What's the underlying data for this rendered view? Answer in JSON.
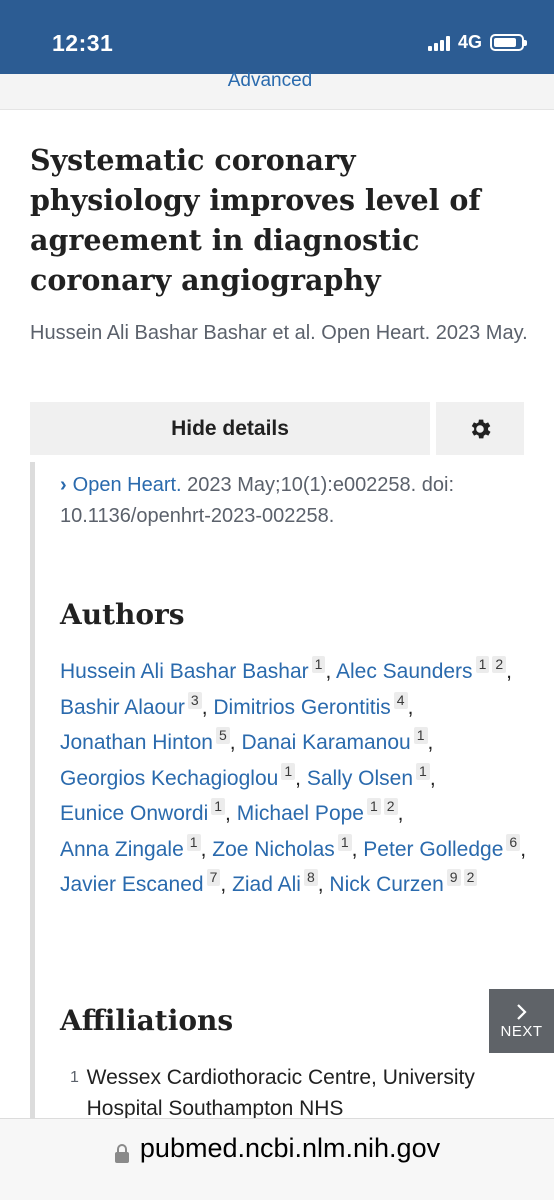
{
  "status_bar": {
    "time": "12:31",
    "network": "4G",
    "battery_level": 0.85
  },
  "search": {
    "advanced_label": "Advanced"
  },
  "article": {
    "title": "Systematic coronary physiology improves level of agreement in diagnostic coronary angiography",
    "short_citation": "Hussein Ali Bashar Bashar et al. Open Heart. 2023 May.",
    "journal": "Open Heart.",
    "journal_details": " 2023 May;10(1):e002258. doi: 10.1136/openhrt-2023-002258."
  },
  "controls": {
    "hide_details_label": "Hide details",
    "settings_icon": "gear-icon",
    "next_label": "NEXT"
  },
  "authors": {
    "heading": "Authors",
    "items": [
      {
        "name": "Hussein Ali Bashar Bashar",
        "sups": [
          "1"
        ]
      },
      {
        "name": "Alec Saunders",
        "sups": [
          "1",
          "2"
        ]
      },
      {
        "name": "Bashir Alaour",
        "sups": [
          "3"
        ]
      },
      {
        "name": "Dimitrios Gerontitis",
        "sups": [
          "4"
        ]
      },
      {
        "name": "Jonathan Hinton",
        "sups": [
          "5"
        ]
      },
      {
        "name": "Danai Karamanou",
        "sups": [
          "1"
        ]
      },
      {
        "name": "Georgios Kechagioglou",
        "sups": [
          "1"
        ]
      },
      {
        "name": "Sally Olsen",
        "sups": [
          "1"
        ]
      },
      {
        "name": "Eunice Onwordi",
        "sups": [
          "1"
        ]
      },
      {
        "name": "Michael Pope",
        "sups": [
          "1",
          "2"
        ]
      },
      {
        "name": "Anna Zingale",
        "sups": [
          "1"
        ]
      },
      {
        "name": "Zoe Nicholas",
        "sups": [
          "1"
        ]
      },
      {
        "name": "Peter Golledge",
        "sups": [
          "6"
        ]
      },
      {
        "name": "Javier Escaned",
        "sups": [
          "7"
        ]
      },
      {
        "name": "Ziad Ali",
        "sups": [
          "8"
        ]
      },
      {
        "name": "Nick Curzen",
        "sups": [
          "9",
          "2"
        ]
      }
    ]
  },
  "affiliations": {
    "heading": "Affiliations",
    "items": [
      {
        "num": "1",
        "text": "Wessex Cardiothoracic Centre, University Hospital Southampton NHS"
      }
    ]
  },
  "browser": {
    "url": "pubmed.ncbi.nlm.nih.gov"
  },
  "colors": {
    "header_blue": "#2c5c93",
    "link_blue": "#2a6aad",
    "next_button_gray": "#5f6368"
  }
}
